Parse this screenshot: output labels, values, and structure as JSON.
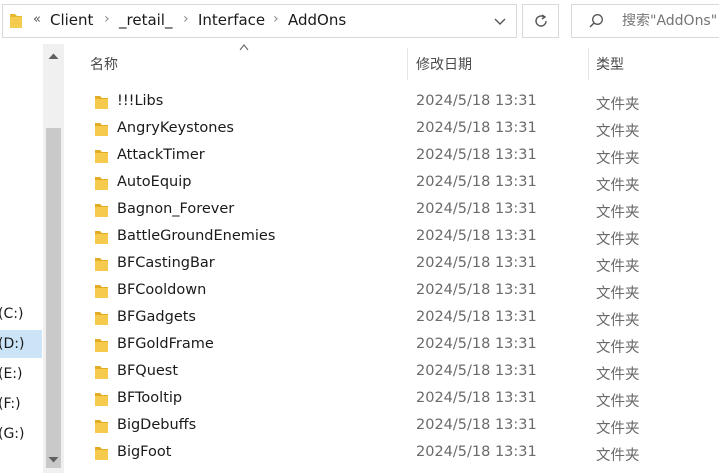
{
  "address_bar": {
    "overflow": "«",
    "breadcrumbs": [
      "Client",
      "_retail_",
      "Interface",
      "AddOns"
    ]
  },
  "search": {
    "placeholder": "搜索\"AddOns\""
  },
  "nav": {
    "drives": [
      {
        "label": "(C:)",
        "selected": false
      },
      {
        "label": "(D:)",
        "selected": true
      },
      {
        "label": "(E:)",
        "selected": false
      },
      {
        "label": "(F:)",
        "selected": false
      },
      {
        "label": "(G:)",
        "selected": false
      }
    ]
  },
  "columns": {
    "name": "名称",
    "date": "修改日期",
    "type": "类型"
  },
  "files": [
    {
      "name": "!!!Libs",
      "date": "2024/5/18 13:31",
      "type": "文件夹"
    },
    {
      "name": "AngryKeystones",
      "date": "2024/5/18 13:31",
      "type": "文件夹"
    },
    {
      "name": "AttackTimer",
      "date": "2024/5/18 13:31",
      "type": "文件夹"
    },
    {
      "name": "AutoEquip",
      "date": "2024/5/18 13:31",
      "type": "文件夹"
    },
    {
      "name": "Bagnon_Forever",
      "date": "2024/5/18 13:31",
      "type": "文件夹"
    },
    {
      "name": "BattleGroundEnemies",
      "date": "2024/5/18 13:31",
      "type": "文件夹"
    },
    {
      "name": "BFCastingBar",
      "date": "2024/5/18 13:31",
      "type": "文件夹"
    },
    {
      "name": "BFCooldown",
      "date": "2024/5/18 13:31",
      "type": "文件夹"
    },
    {
      "name": "BFGadgets",
      "date": "2024/5/18 13:31",
      "type": "文件夹"
    },
    {
      "name": "BFGoldFrame",
      "date": "2024/5/18 13:31",
      "type": "文件夹"
    },
    {
      "name": "BFQuest",
      "date": "2024/5/18 13:31",
      "type": "文件夹"
    },
    {
      "name": "BFTooltip",
      "date": "2024/5/18 13:31",
      "type": "文件夹"
    },
    {
      "name": "BigDebuffs",
      "date": "2024/5/18 13:31",
      "type": "文件夹"
    },
    {
      "name": "BigFoot",
      "date": "2024/5/18 13:31",
      "type": "文件夹"
    }
  ],
  "colors": {
    "folder": "#f0c040",
    "selected": "#cce4f7"
  }
}
